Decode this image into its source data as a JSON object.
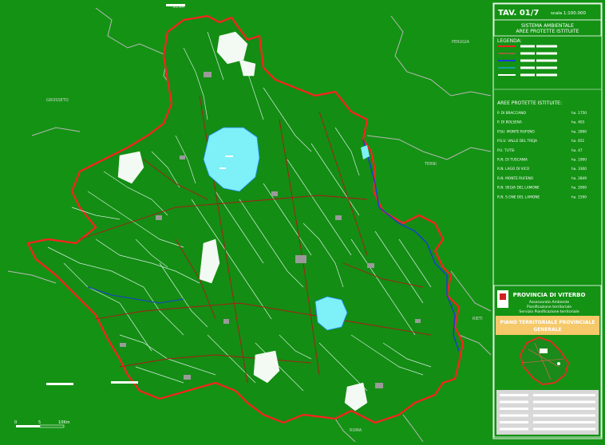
{
  "sheet": {
    "code": "TAV. 01/7",
    "scale": "scala 1:100.000"
  },
  "title": {
    "line1": "SISTEMA AMBIENTALE",
    "line2": "AREE PROTETTE ISTITUITE"
  },
  "legend_title": "LEGENDA:",
  "legend_colors": [
    "#ff2020",
    "#8a6a3a",
    "#1a3ad8",
    "#1aa0a0",
    "#ffffff"
  ],
  "areas_title": "AREE PROTETTE ISTITUITE:",
  "areas": [
    {
      "name": "P. DI BRACCIANO",
      "ha": "ha. 1750"
    },
    {
      "name": "P. DI BOLSENA",
      "ha": "ha. 403"
    },
    {
      "name": "P.SU. MONTE RUFENO",
      "ha": "ha. 2890"
    },
    {
      "name": "P.S.U. VALLE DEL TREJA",
      "ha": "ha. 651"
    },
    {
      "name": "P.U. TUTSI",
      "ha": "ha. 47"
    },
    {
      "name": "R.N. DI TUSCANIA",
      "ha": "ha. 1900"
    },
    {
      "name": "R.N. LAGO DI VICO",
      "ha": "ha. 3300"
    },
    {
      "name": "R.N. MONTE RUFENO",
      "ha": "ha. 2849"
    },
    {
      "name": "R.N. SELVA DEL LAMONE",
      "ha": "ha. 2000"
    },
    {
      "name": "R.N. S.ONE DEL LAMONE",
      "ha": "ha. 1590"
    }
  ],
  "logo": {
    "org": "PROVINCIA DI VITERBO",
    "dept1": "Assessorato Ambiente",
    "dept2": "Pianificazione territoriale",
    "dept3": "Servizio Pianificazione territoriale",
    "plan1": "PIANO TERRITORIALE PROVINCIALE",
    "plan2": "GENERALE"
  },
  "context_labels": {
    "top": "SIENA",
    "perugia": "PERUGIA",
    "grosseto": "GROSSETO",
    "terni": "TERNI",
    "rieti": "RIETI",
    "roma": "ROMA"
  },
  "scalebar": {
    "t0": "0",
    "t5": "5",
    "t10": "10Km"
  },
  "colors": {
    "background": "#149214",
    "boundary": "#ff2020",
    "river": "#1a3ad8",
    "lake": "#7df0f8",
    "urban": "#9a9a9a"
  }
}
